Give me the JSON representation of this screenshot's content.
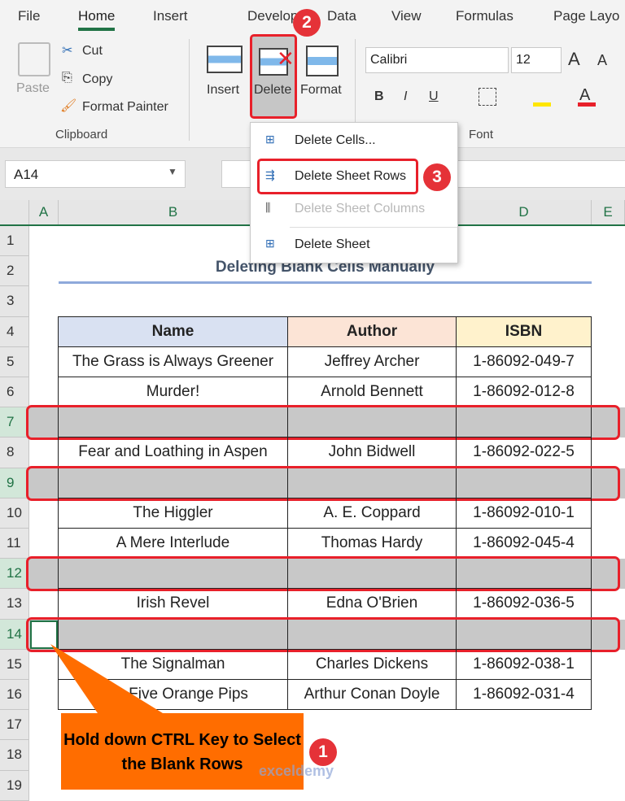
{
  "tabs": [
    "File",
    "Home",
    "Insert",
    "Developer",
    "Data",
    "View",
    "Formulas",
    "Page Layo"
  ],
  "clipboard": {
    "paste": "Paste",
    "cut": "Cut",
    "copy": "Copy",
    "format_painter": "Format Painter",
    "group": "Clipboard"
  },
  "cells_group": {
    "insert": "Insert",
    "delete": "Delete",
    "format": "Format"
  },
  "font": {
    "name": "Calibri",
    "size": "12",
    "group": "Font",
    "bold": "B",
    "italic": "I",
    "underline": "U",
    "grow": "A",
    "shrink": "A"
  },
  "name_box": "A14",
  "menu": {
    "items": [
      {
        "label": "Delete Cells...",
        "disabled": false
      },
      {
        "label": "Delete Sheet Rows",
        "disabled": false
      },
      {
        "label": "Delete Sheet Columns",
        "disabled": true
      },
      {
        "label": "Delete Sheet",
        "disabled": false
      }
    ]
  },
  "columns": [
    "A",
    "B",
    "C",
    "D",
    "E"
  ],
  "rows": [
    "1",
    "2",
    "3",
    "4",
    "5",
    "6",
    "7",
    "8",
    "9",
    "10",
    "11",
    "12",
    "13",
    "14",
    "15",
    "16",
    "17",
    "18",
    "19"
  ],
  "sheet": {
    "title": "Deleting Blank Cells Manually",
    "headers": [
      "Name",
      "Author",
      "ISBN"
    ],
    "data": [
      {
        "row": 5,
        "cells": [
          "The Grass is Always Greener",
          "Jeffrey Archer",
          "1-86092-049-7"
        ]
      },
      {
        "row": 6,
        "cells": [
          "Murder!",
          "Arnold Bennett",
          "1-86092-012-8"
        ]
      },
      {
        "row": 7,
        "cells": [
          "",
          "",
          ""
        ]
      },
      {
        "row": 8,
        "cells": [
          "Fear and Loathing in Aspen",
          "John Bidwell",
          "1-86092-022-5"
        ]
      },
      {
        "row": 9,
        "cells": [
          "",
          "",
          ""
        ]
      },
      {
        "row": 10,
        "cells": [
          "The Higgler",
          "A. E. Coppard",
          "1-86092-010-1"
        ]
      },
      {
        "row": 11,
        "cells": [
          "A Mere Interlude",
          "Thomas Hardy",
          "1-86092-045-4"
        ]
      },
      {
        "row": 12,
        "cells": [
          "",
          "",
          ""
        ]
      },
      {
        "row": 13,
        "cells": [
          "Irish Revel",
          "Edna O'Brien",
          "1-86092-036-5"
        ]
      },
      {
        "row": 14,
        "cells": [
          "",
          "",
          ""
        ]
      },
      {
        "row": 15,
        "cells": [
          "The Signalman",
          "Charles Dickens",
          "1-86092-038-1"
        ]
      },
      {
        "row": 16,
        "cells": [
          "The Five Orange Pips",
          "Arthur Conan Doyle",
          "1-86092-031-4"
        ]
      }
    ]
  },
  "callout": "Hold down CTRL Key to Select the Blank Rows",
  "badges": [
    "1",
    "2",
    "3"
  ],
  "watermark": "exceldemy EXCEL · DATA · BI",
  "colors": {
    "accent": "#217346",
    "highlight_red": "#e8202a",
    "callout": "#ff6d00",
    "blank_row": "#c8c8c8",
    "name_header": "#d9e1f2",
    "author_header": "#fce4d6",
    "isbn_header": "#fff2cc"
  }
}
